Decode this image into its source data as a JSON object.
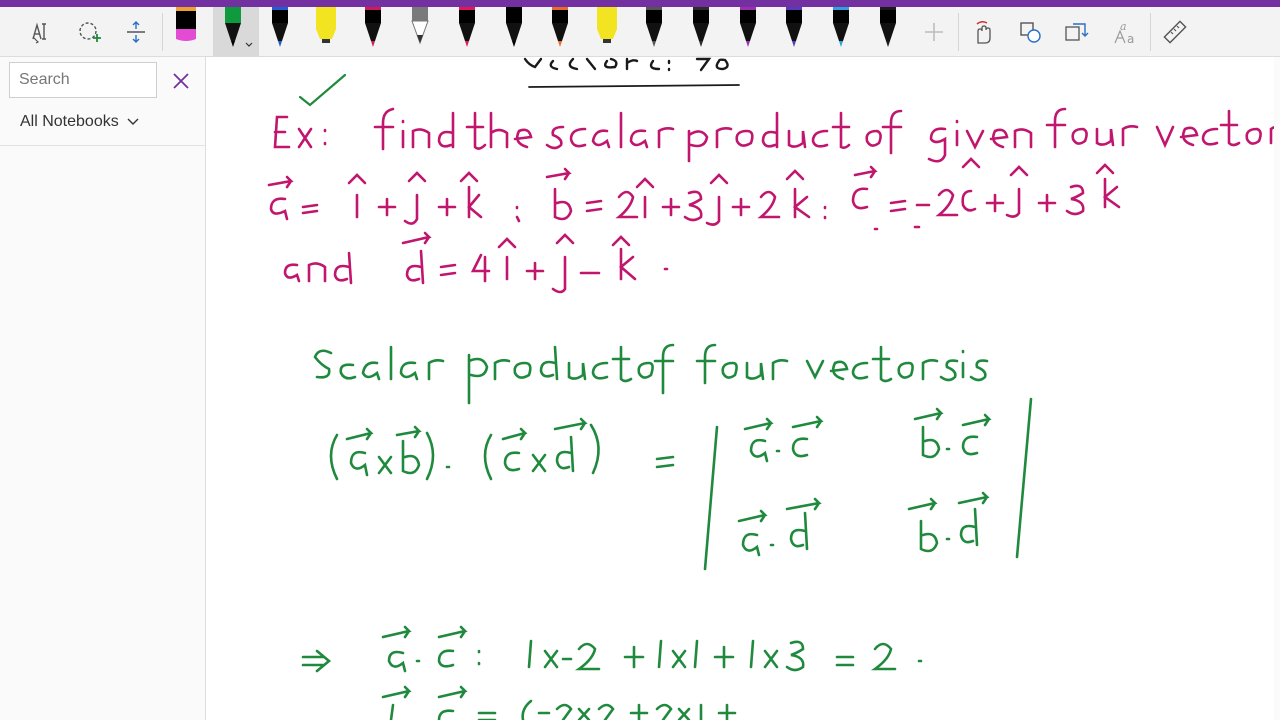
{
  "colors": {
    "accent": "#7230a0",
    "ink_magenta": "#c0166e",
    "ink_green": "#1f8a3e"
  },
  "toolbar": {
    "tools": [
      {
        "name": "lasso-select-icon"
      },
      {
        "name": "shape-select-icon"
      },
      {
        "name": "add-space-icon"
      }
    ],
    "pens": [
      {
        "color": "#000000",
        "tip": "#e34bd4",
        "kind": "highlighter"
      },
      {
        "color": "#109a3e",
        "tip": "#000000",
        "kind": "pen",
        "selected": true
      },
      {
        "color": "#000000",
        "tip": "#1f5fd0",
        "kind": "pen"
      },
      {
        "color": "#f3e422",
        "tip": "#f3e422",
        "kind": "highlighter"
      },
      {
        "color": "#000000",
        "tip": "#d0195e",
        "kind": "pen"
      },
      {
        "color": "#8a8a8a",
        "tip": "#c8c8c8",
        "kind": "pencil"
      },
      {
        "color": "#000000",
        "tip": "#e0185a",
        "kind": "pen"
      },
      {
        "color": "#000000",
        "tip": "#000000",
        "kind": "pen"
      },
      {
        "color": "#000000",
        "tip": "#e8692a",
        "kind": "pen"
      },
      {
        "color": "#f3e422",
        "tip": "#f3e422",
        "kind": "highlighter"
      },
      {
        "color": "#000000",
        "tip": "#555555",
        "kind": "pen"
      },
      {
        "color": "#000000",
        "tip": "#2c2c2c",
        "kind": "pen"
      },
      {
        "color": "#000000",
        "tip": "#9b2fb0",
        "kind": "pen"
      },
      {
        "color": "#000000",
        "tip": "#5a3ab8",
        "kind": "pen"
      },
      {
        "color": "#000000",
        "tip": "#2ba3e0",
        "kind": "pen"
      },
      {
        "color": "#000000",
        "tip": "#1b1b1b",
        "kind": "pen"
      }
    ],
    "right_tools": [
      {
        "name": "add-pen-icon"
      },
      {
        "name": "ink-to-shape-icon"
      },
      {
        "name": "shapes-icon"
      },
      {
        "name": "ink-replay-icon"
      },
      {
        "name": "ink-to-text-icon"
      },
      {
        "name": "ruler-icon"
      }
    ]
  },
  "sidebar": {
    "search_placeholder": "Search",
    "notebooks_label": "All Notebooks"
  }
}
